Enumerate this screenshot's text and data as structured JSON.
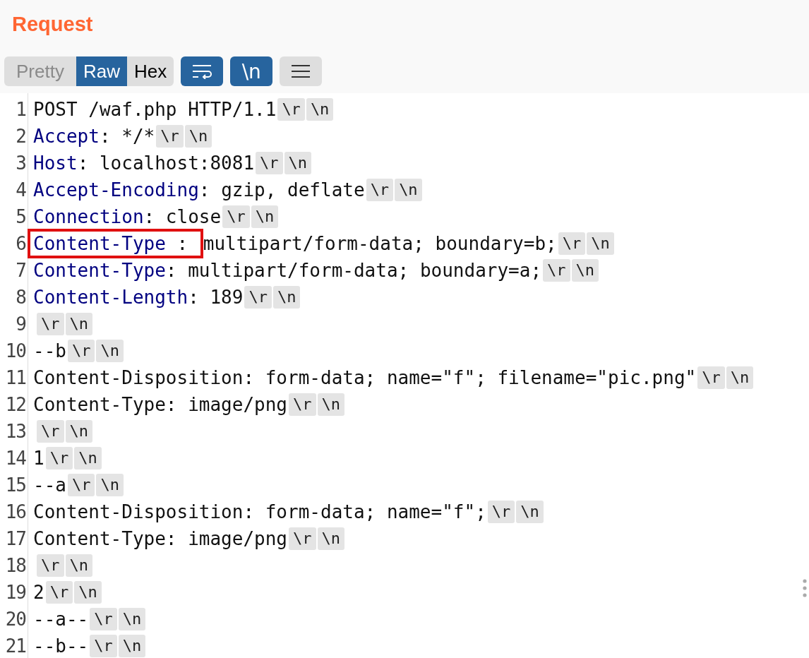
{
  "panel": {
    "title": "Request"
  },
  "view_tabs": [
    {
      "label": "Pretty",
      "selected": false
    },
    {
      "label": "Raw",
      "selected": true
    },
    {
      "label": "Hex",
      "selected": false
    }
  ],
  "toggles": [
    {
      "kind": "wrap",
      "on": true
    },
    {
      "kind": "newline",
      "label": "\\n",
      "on": true
    },
    {
      "kind": "menu",
      "on": false
    }
  ],
  "lines": [
    {
      "number": "1",
      "value": "POST /waf.php HTTP/1.1",
      "escapes": [
        "\\r",
        "\\n"
      ],
      "highlighted": false
    },
    {
      "number": "2",
      "key": "Accept",
      "separator": ": ",
      "value": "*/*",
      "escapes": [
        "\\r",
        "\\n"
      ],
      "highlighted": false
    },
    {
      "number": "3",
      "key": "Host",
      "separator": ": ",
      "value": "localhost:8081",
      "escapes": [
        "\\r",
        "\\n"
      ],
      "highlighted": false
    },
    {
      "number": "4",
      "key": "Accept-Encoding",
      "separator": ": ",
      "value": "gzip, deflate",
      "escapes": [
        "\\r",
        "\\n"
      ],
      "highlighted": false
    },
    {
      "number": "5",
      "key": "Connection",
      "separator": ": ",
      "value": "close",
      "escapes": [
        "\\r",
        "\\n"
      ],
      "highlighted": false
    },
    {
      "number": "6",
      "key": "Content-Type",
      "separator": " : ",
      "value": "multipart/form-data; boundary=b;",
      "escapes": [
        "\\r",
        "\\n"
      ],
      "highlighted": true
    },
    {
      "number": "7",
      "key": "Content-Type",
      "separator": ": ",
      "value": "multipart/form-data; boundary=a;",
      "escapes": [
        "\\r",
        "\\n"
      ],
      "highlighted": false
    },
    {
      "number": "8",
      "key": "Content-Length",
      "separator": ": ",
      "value": "189",
      "escapes": [
        "\\r",
        "\\n"
      ],
      "highlighted": false
    },
    {
      "number": "9",
      "escapes": [
        "\\r",
        "\\n"
      ],
      "highlighted": false
    },
    {
      "number": "10",
      "value": "--b",
      "escapes": [
        "\\r",
        "\\n"
      ],
      "highlighted": false
    },
    {
      "number": "11",
      "value": "Content-Disposition: form-data; name=\"f\"; filename=\"pic.png\"",
      "escapes": [
        "\\r",
        "\\n"
      ],
      "highlighted": false
    },
    {
      "number": "12",
      "value": "Content-Type: image/png",
      "escapes": [
        "\\r",
        "\\n"
      ],
      "highlighted": false
    },
    {
      "number": "13",
      "escapes": [
        "\\r",
        "\\n"
      ],
      "highlighted": false
    },
    {
      "number": "14",
      "value": "1",
      "escapes": [
        "\\r",
        "\\n"
      ],
      "highlighted": false
    },
    {
      "number": "15",
      "value": "--a",
      "escapes": [
        "\\r",
        "\\n"
      ],
      "highlighted": false
    },
    {
      "number": "16",
      "value": "Content-Disposition: form-data; name=\"f\";",
      "escapes": [
        "\\r",
        "\\n"
      ],
      "highlighted": false
    },
    {
      "number": "17",
      "value": "Content-Type: image/png",
      "escapes": [
        "\\r",
        "\\n"
      ],
      "highlighted": false
    },
    {
      "number": "18",
      "escapes": [
        "\\r",
        "\\n"
      ],
      "highlighted": false
    },
    {
      "number": "19",
      "value": "2",
      "escapes": [
        "\\r",
        "\\n"
      ],
      "highlighted": false
    },
    {
      "number": "20",
      "value": "--a--",
      "escapes": [
        "\\r",
        "\\n"
      ],
      "highlighted": false
    },
    {
      "number": "21",
      "value": "--b--",
      "escapes": [
        "\\r",
        "\\n"
      ],
      "highlighted": false
    }
  ]
}
